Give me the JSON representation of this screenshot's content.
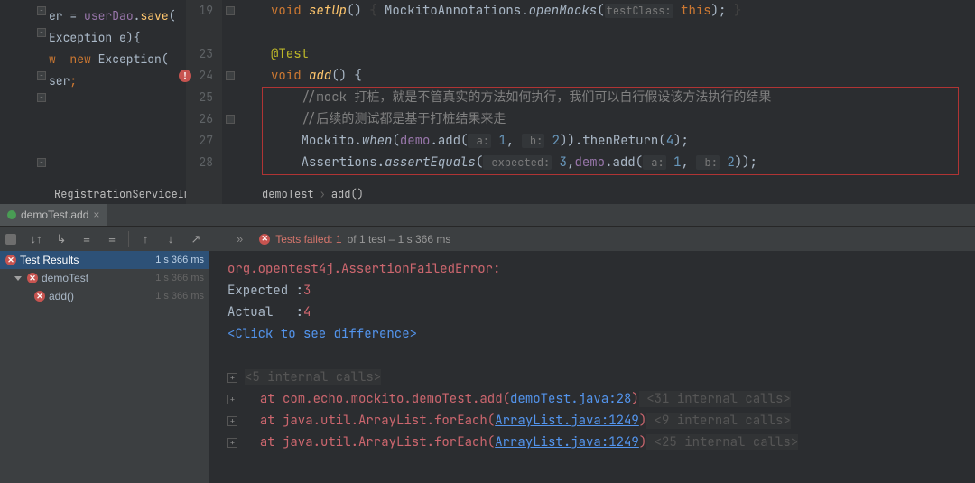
{
  "left_editor": {
    "lines": [
      "er = userDao.save(",
      "Exception e){",
      "w  new Exception(",
      "",
      "ser;"
    ],
    "tab_label": "RegistrationServiceImpl"
  },
  "gutter": [
    "19",
    "",
    "23",
    "24",
    "25",
    "26",
    "27",
    "28",
    ""
  ],
  "right_editor": {
    "l19_kw": "void ",
    "l19_name": "setUp",
    "l19_rest1": "() ",
    "l19_brace1": "{",
    "l19_call": " MockitoAnnotations.",
    "l19_method": "openMocks",
    "l19_hint": "testClass:",
    "l19_this": "this",
    "l19_rest2": "); ",
    "l19_brace2": "}",
    "l23_ann": "@Test",
    "l24_kw": "void ",
    "l24_name": "add",
    "l24_rest": "() {",
    "l25": "//mock 打桩，就是不管真实的方法如何执行，我们可以自行假设该方法执行的结果",
    "l26": "//后续的测试都是基于打桩结果来走",
    "l27_a": "Mockito.",
    "l27_when": "when",
    "l27_b": "(",
    "l27_demo": "demo",
    "l27_c": ".add(",
    "l27_h1": " a:",
    "l27_n1": " 1",
    "l27_comma": ", ",
    "l27_h2": " b:",
    "l27_n2": " 2",
    "l27_d": ")).thenReturn(",
    "l27_n3": "4",
    "l27_e": ");",
    "l28_a": "Assertions.",
    "l28_m": "assertEquals",
    "l28_b": "(",
    "l28_h1": " expected:",
    "l28_n1": " 3",
    "l28_c": ",",
    "l28_demo": "demo",
    "l28_d": ".add(",
    "l28_h2": " a:",
    "l28_n2": " 1",
    "l28_comma": ", ",
    "l28_h3": " b:",
    "l28_n3": " 2",
    "l28_e": "));",
    "crumb1": "demoTest",
    "crumb2": "add()"
  },
  "run_tab": {
    "label": "demoTest.add",
    "close": "×"
  },
  "toolbar": {
    "arrows": "»"
  },
  "status": {
    "label": "Tests failed: 1",
    "rest": " of 1 test – 1 s 366 ms"
  },
  "tree": {
    "root": "Test Results",
    "root_time": "1 s 366 ms",
    "class": "demoTest",
    "class_time": "1 s 366 ms",
    "method": "add()",
    "method_time": "1 s 366 ms"
  },
  "console": {
    "l1": "org.opentest4j.AssertionFailedError:",
    "l2a": "Expected :",
    "l2b": "3",
    "l3a": "Actual   :",
    "l3b": "4",
    "l4": "<Click to see difference>",
    "l5": "<5 internal calls>",
    "l6a": "at com.echo.mockito.demoTest.add(",
    "l6link": "demoTest.java:28",
    "l6b": ")",
    "l6c": " <31 internal calls>",
    "l7a": "at java.util.ArrayList.forEach(",
    "l7link": "ArrayList.java:1249",
    "l7b": ")",
    "l7c": " <9 internal calls>",
    "l8a": "at java.util.ArrayList.forEach(",
    "l8link": "ArrayList.java:1249",
    "l8b": ")",
    "l8c": " <25 internal calls>"
  }
}
